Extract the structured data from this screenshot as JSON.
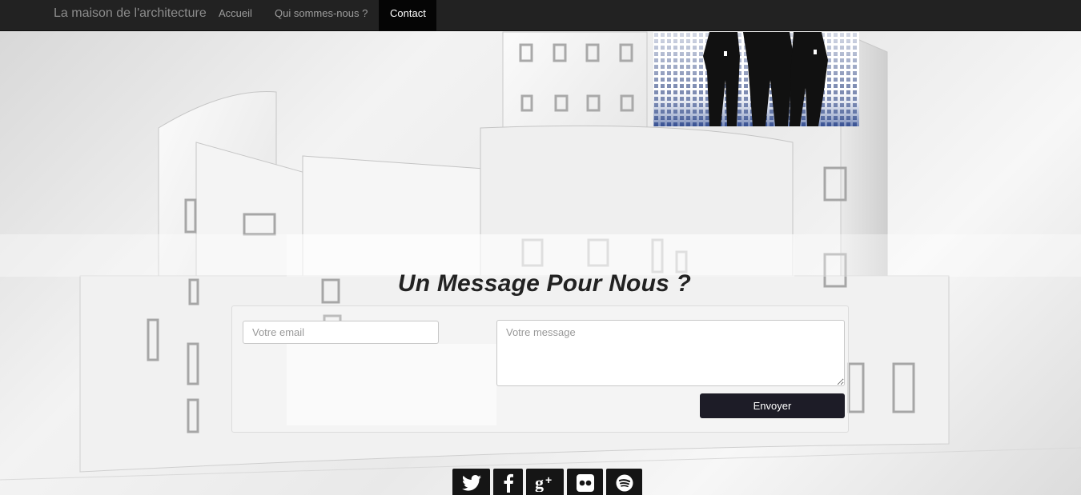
{
  "navbar": {
    "brand": "La maison de l'architecture",
    "links": [
      {
        "label": "Accueil",
        "active": false
      },
      {
        "label": "Qui sommes-nous ?",
        "active": false
      },
      {
        "label": "Contact",
        "active": true
      }
    ]
  },
  "contact": {
    "title": "Un Message Pour Nous ?",
    "email_placeholder": "Votre email",
    "message_placeholder": "Votre message",
    "submit_label": "Envoyer"
  },
  "social": [
    "twitter-icon",
    "facebook-icon",
    "google-plus-icon",
    "flickr-icon",
    "spotify-icon"
  ],
  "colors": {
    "navbar_bg": "#222222",
    "active_tab_bg": "#050505",
    "button_bg": "#1d1c27"
  }
}
